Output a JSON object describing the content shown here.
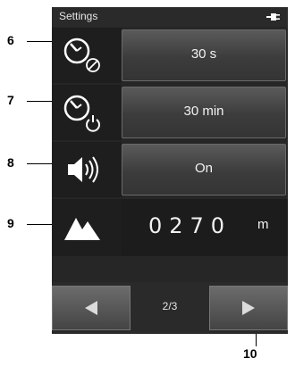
{
  "status_bar": {
    "title": "Settings",
    "power_icon": "plug-icon"
  },
  "rows": [
    {
      "icon": "screen-timeout-icon",
      "value": "30 s"
    },
    {
      "icon": "auto-power-off-icon",
      "value": "30 min"
    },
    {
      "icon": "speaker-icon",
      "value": "On"
    }
  ],
  "altitude": {
    "icon": "mountain-icon",
    "digits": "0270",
    "unit": "m"
  },
  "nav": {
    "prev_icon": "arrow-left-icon",
    "next_icon": "arrow-right-icon",
    "page": "2/3"
  },
  "callouts": [
    "6",
    "7",
    "8",
    "9",
    "10"
  ]
}
